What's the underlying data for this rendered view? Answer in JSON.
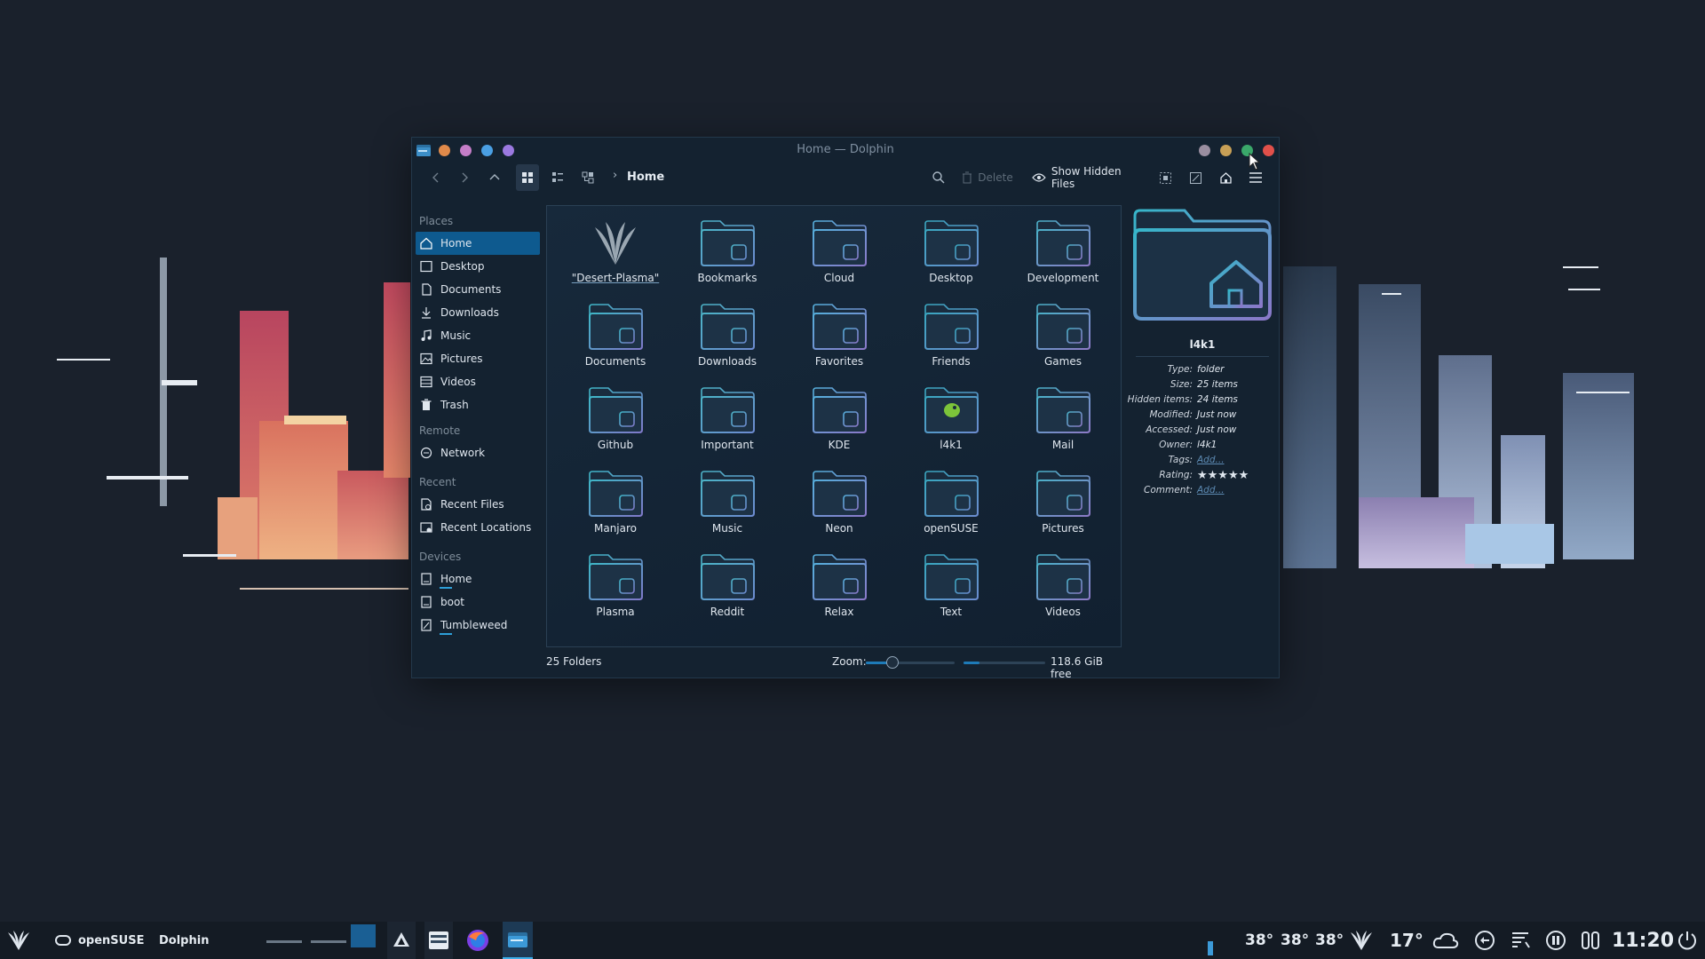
{
  "window": {
    "title": "Home — Dolphin",
    "traffic_left": [
      "#e08a4a",
      "#c57ec8",
      "#4a9fe3",
      "#9b79e0"
    ],
    "traffic_right": [
      "#9a8ea0",
      "#c8a056",
      "#3aa86a",
      "#e0504a"
    ]
  },
  "toolbar": {
    "breadcrumb": "Home",
    "delete_label": "Delete",
    "show_hidden_label": "Show Hidden Files"
  },
  "sidebar": {
    "places_header": "Places",
    "places": [
      "Home",
      "Desktop",
      "Documents",
      "Downloads",
      "Music",
      "Pictures",
      "Videos",
      "Trash"
    ],
    "remote_header": "Remote",
    "remote": [
      "Network"
    ],
    "recent_header": "Recent",
    "recent": [
      "Recent Files",
      "Recent Locations"
    ],
    "devices_header": "Devices",
    "devices": [
      "Home",
      "boot",
      "Tumbleweed"
    ]
  },
  "folders": [
    {
      "label": "\"Desert-Plasma\"",
      "icon": "plasma-logo-icon"
    },
    {
      "label": "Bookmarks",
      "icon": "bookmark-folder-icon"
    },
    {
      "label": "Cloud",
      "icon": "cloud-folder-icon"
    },
    {
      "label": "Desktop",
      "icon": "desktop-folder-icon"
    },
    {
      "label": "Development",
      "icon": "development-folder-icon"
    },
    {
      "label": "Documents",
      "icon": "documents-folder-icon"
    },
    {
      "label": "Downloads",
      "icon": "downloads-folder-icon"
    },
    {
      "label": "Favorites",
      "icon": "favorites-folder-icon"
    },
    {
      "label": "Friends",
      "icon": "friends-folder-icon"
    },
    {
      "label": "Games",
      "icon": "games-folder-icon"
    },
    {
      "label": "Github",
      "icon": "github-folder-icon"
    },
    {
      "label": "Important",
      "icon": "important-folder-icon"
    },
    {
      "label": "KDE",
      "icon": "kde-folder-icon"
    },
    {
      "label": "l4k1",
      "icon": "chameleon-folder-icon"
    },
    {
      "label": "Mail",
      "icon": "mail-folder-icon"
    },
    {
      "label": "Manjaro",
      "icon": "manjaro-folder-icon"
    },
    {
      "label": "Music",
      "icon": "music-folder-icon"
    },
    {
      "label": "Neon",
      "icon": "neon-folder-icon"
    },
    {
      "label": "openSUSE",
      "icon": "opensuse-folder-icon"
    },
    {
      "label": "Pictures",
      "icon": "pictures-folder-icon"
    },
    {
      "label": "Plasma",
      "icon": "plasma-folder-icon"
    },
    {
      "label": "Reddit",
      "icon": "reddit-folder-icon"
    },
    {
      "label": "Relax",
      "icon": "relax-folder-icon"
    },
    {
      "label": "Text",
      "icon": "text-folder-icon"
    },
    {
      "label": "Videos",
      "icon": "videos-folder-icon"
    }
  ],
  "status": {
    "count": "25 Folders",
    "zoom_label": "Zoom:",
    "zoom_level": 0.3,
    "free_space": "118.6 GiB free",
    "used_fraction": 0.2
  },
  "info": {
    "name": "l4k1",
    "rows": [
      {
        "k": "Type:",
        "v": "folder"
      },
      {
        "k": "Size:",
        "v": "25 items"
      },
      {
        "k": "Hidden items:",
        "v": "24 items"
      },
      {
        "k": "Modified:",
        "v": "Just now"
      },
      {
        "k": "Accessed:",
        "v": "Just now"
      },
      {
        "k": "Owner:",
        "v": "l4k1"
      },
      {
        "k": "Tags:",
        "v": "Add..."
      },
      {
        "k": "Rating:",
        "v": ""
      },
      {
        "k": "Comment:",
        "v": "Add..."
      }
    ],
    "rating": 5
  },
  "taskbar": {
    "distro_label": "openSUSE",
    "app_label": "Dolphin",
    "temps": [
      "38°",
      "38°",
      "38°"
    ],
    "weather_temp": "17°",
    "clock": "11:20"
  }
}
